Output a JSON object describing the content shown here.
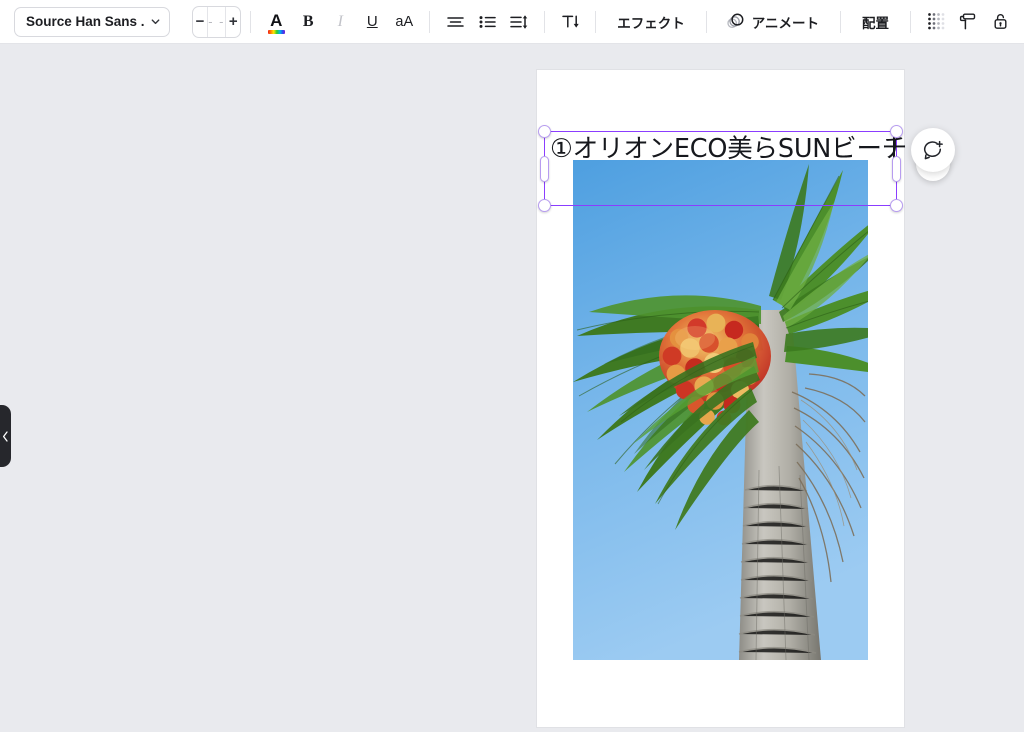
{
  "toolbar": {
    "font_family": {
      "value": "Source Han Sans ...",
      "icon": "chevron-down-icon"
    },
    "font_size": {
      "value": "- -",
      "decrease_label": "−",
      "increase_label": "+"
    },
    "text_color": {
      "label": "A",
      "icon": "text-color-icon"
    },
    "bold": {
      "label": "B",
      "icon": "bold-icon"
    },
    "italic": {
      "label": "I",
      "icon": "italic-icon"
    },
    "underline": {
      "label": "U",
      "icon": "underline-icon"
    },
    "letter_case": {
      "label": "aA",
      "icon": "letter-case-icon"
    },
    "align": {
      "icon": "text-align-icon"
    },
    "bullet_list": {
      "icon": "bullet-list-icon"
    },
    "line_spacing": {
      "icon": "line-spacing-icon"
    },
    "vertical_text": {
      "label": "T↓",
      "icon": "vertical-text-icon"
    },
    "effects": {
      "label": "エフェクト"
    },
    "animate": {
      "label": "アニメート",
      "icon": "animate-icon"
    },
    "position": {
      "label": "配置"
    },
    "transparency": {
      "icon": "transparency-icon"
    },
    "copy_style": {
      "icon": "paint-roller-icon"
    },
    "lock": {
      "icon": "unlocked-padlock-icon"
    }
  },
  "canvas": {
    "panel_toggle": {
      "icon": "chevron-left-icon"
    },
    "background_color": "#e9eaee",
    "page": {
      "background_color": "#ffffff",
      "text_element": {
        "content": "①オリオンECO美らSUNビーチ",
        "selection_color": "#8b3dff",
        "state": "editing"
      },
      "image_element": {
        "alt": "palm-tree-with-red-orange-fruit-clusters-against-blue-sky"
      }
    }
  },
  "floating_buttons": {
    "add_comment": {
      "icon": "add-comment-icon"
    },
    "secondary": {
      "icon": "refresh-icon"
    }
  }
}
